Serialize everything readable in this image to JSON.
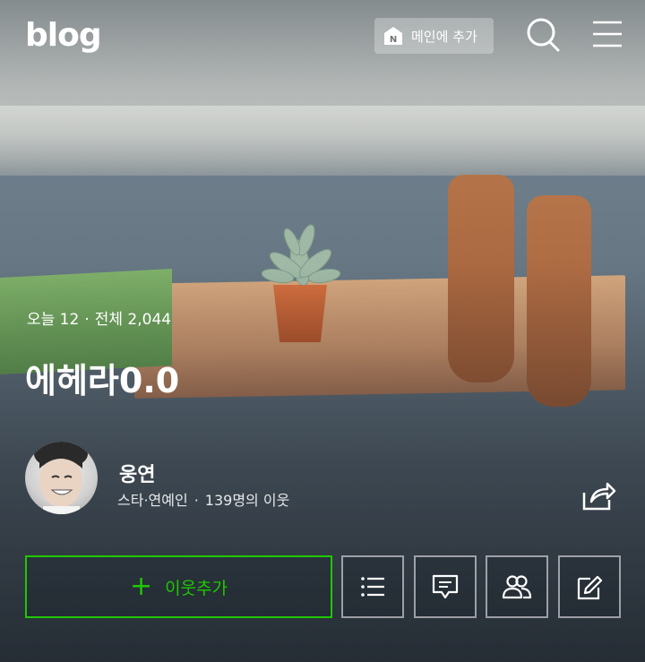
{
  "header": {
    "logo": "blog",
    "add_main_label": "메인에 추가",
    "icons": [
      "n-icon",
      "search-icon",
      "menu-icon"
    ]
  },
  "blog": {
    "today_label": "오늘 12",
    "separator": "·",
    "total_label": "전체 2,044",
    "title": "에헤라0.0"
  },
  "profile": {
    "nickname": "웅연",
    "category": "스타·연예인",
    "separator": "·",
    "neighbors": "139명의 이웃"
  },
  "actions": {
    "add_neighbor_label": "이웃추가",
    "buttons": [
      "list-icon",
      "comment-icon",
      "neighbors-icon",
      "write-icon"
    ]
  },
  "colors": {
    "accent_green": "#1ec800"
  }
}
